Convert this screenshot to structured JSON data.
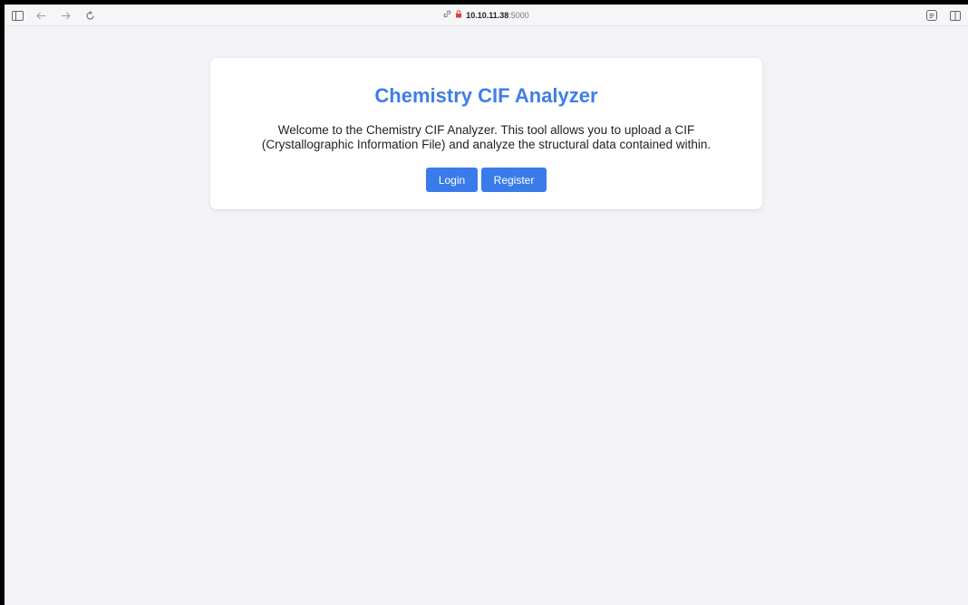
{
  "browser": {
    "url_host": "10.10.11.38",
    "url_port": ":5000",
    "icons": [
      "sidebar-icon",
      "back-arrow-icon",
      "forward-arrow-icon",
      "reload-icon",
      "link-icon",
      "lock-warning-icon",
      "reader-icon",
      "split-view-icon"
    ]
  },
  "page": {
    "title": "Chemistry CIF Analyzer",
    "description": "Welcome to the Chemistry CIF Analyzer. This tool allows you to upload a CIF (Crystallographic Information File) and analyze the structural data contained within.",
    "login_label": "Login",
    "register_label": "Register"
  },
  "colors": {
    "accent": "#3a7bea",
    "title": "#3f7ee8",
    "background": "#f3f3f7"
  }
}
